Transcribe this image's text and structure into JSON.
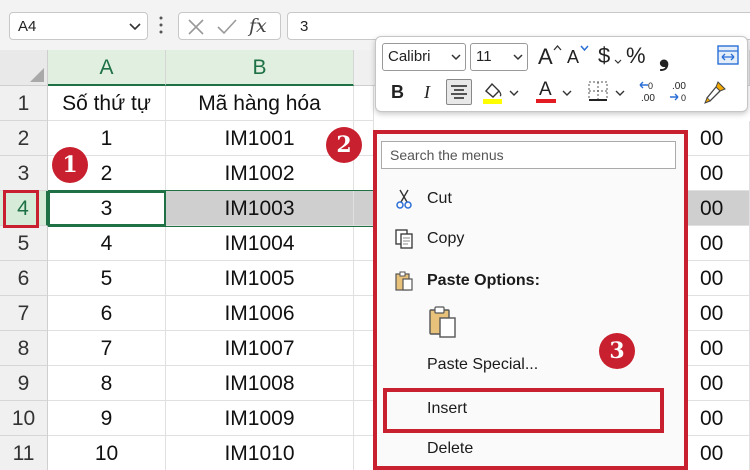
{
  "formula_bar": {
    "name_box": "A4",
    "formula": "3"
  },
  "grid": {
    "columns": [
      "A",
      "B"
    ],
    "rows": [
      "1",
      "2",
      "3",
      "4",
      "5",
      "6",
      "7",
      "8",
      "9",
      "10",
      "11"
    ],
    "header_row": {
      "a": "Số thứ tự",
      "b": "Mã hàng hóa"
    },
    "data": [
      {
        "a": "1",
        "b": "IM1001"
      },
      {
        "a": "2",
        "b": "IM1002"
      },
      {
        "a": "3",
        "b": "IM1003"
      },
      {
        "a": "4",
        "b": "IM1004"
      },
      {
        "a": "5",
        "b": "IM1005"
      },
      {
        "a": "6",
        "b": "IM1006"
      },
      {
        "a": "7",
        "b": "IM1007"
      },
      {
        "a": "8",
        "b": "IM1008"
      },
      {
        "a": "9",
        "b": "IM1009"
      },
      {
        "a": "10",
        "b": "IM1010"
      }
    ],
    "right_fragments": [
      "00",
      "00",
      "00",
      "00",
      "00",
      "00",
      "00",
      "00",
      "00",
      "00"
    ],
    "selected_row": "4"
  },
  "mini_toolbar": {
    "font_name": "Calibri",
    "font_size": "11",
    "bold": "B",
    "italic": "I",
    "currency": "$",
    "percent": "%",
    "comma": "❟",
    "grow_font": "A",
    "shrink_font": "A",
    "font_color_letter": "A",
    "font_color": "#e31b23",
    "fill_color": "#ffff00",
    "inc_decimal": ".00",
    "dec_decimal": ".00"
  },
  "context_menu": {
    "search_placeholder": "Search the menus",
    "items": {
      "cut": "Cut",
      "copy": "Copy",
      "paste_options": "Paste Options:",
      "paste_special": "Paste Special...",
      "insert": "Insert",
      "delete": "Delete"
    }
  },
  "annotations": {
    "step1": "1",
    "step2": "2",
    "step3": "3"
  },
  "colors": {
    "accent_green": "#1e7145",
    "annotation_red": "#c8202e"
  }
}
